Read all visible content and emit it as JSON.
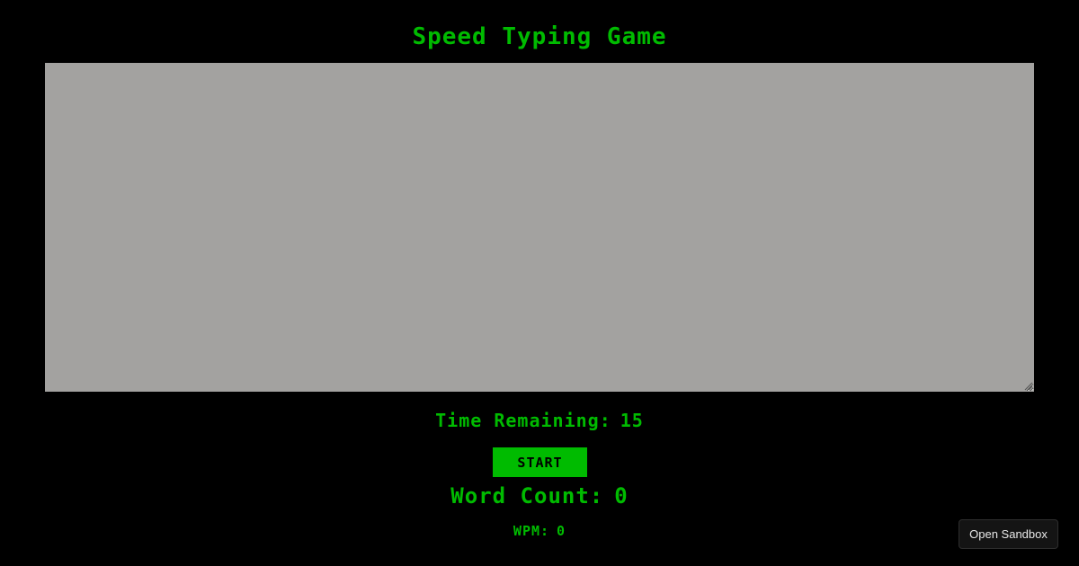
{
  "game": {
    "title": "Speed Typing Game",
    "typing_area": {
      "value": "",
      "placeholder": ""
    },
    "timer": {
      "label": "Time Remaining:",
      "value": "15"
    },
    "start_label": "START",
    "word_count": {
      "label": "Word Count:",
      "value": "0"
    },
    "wpm": {
      "label": "WPM:",
      "value": "0"
    }
  },
  "sandbox": {
    "label": "Open Sandbox"
  },
  "colors": {
    "background": "#000000",
    "accent_green": "#00bb00",
    "textarea_bg": "#a3a2a0",
    "sandbox_bg": "#141414"
  }
}
